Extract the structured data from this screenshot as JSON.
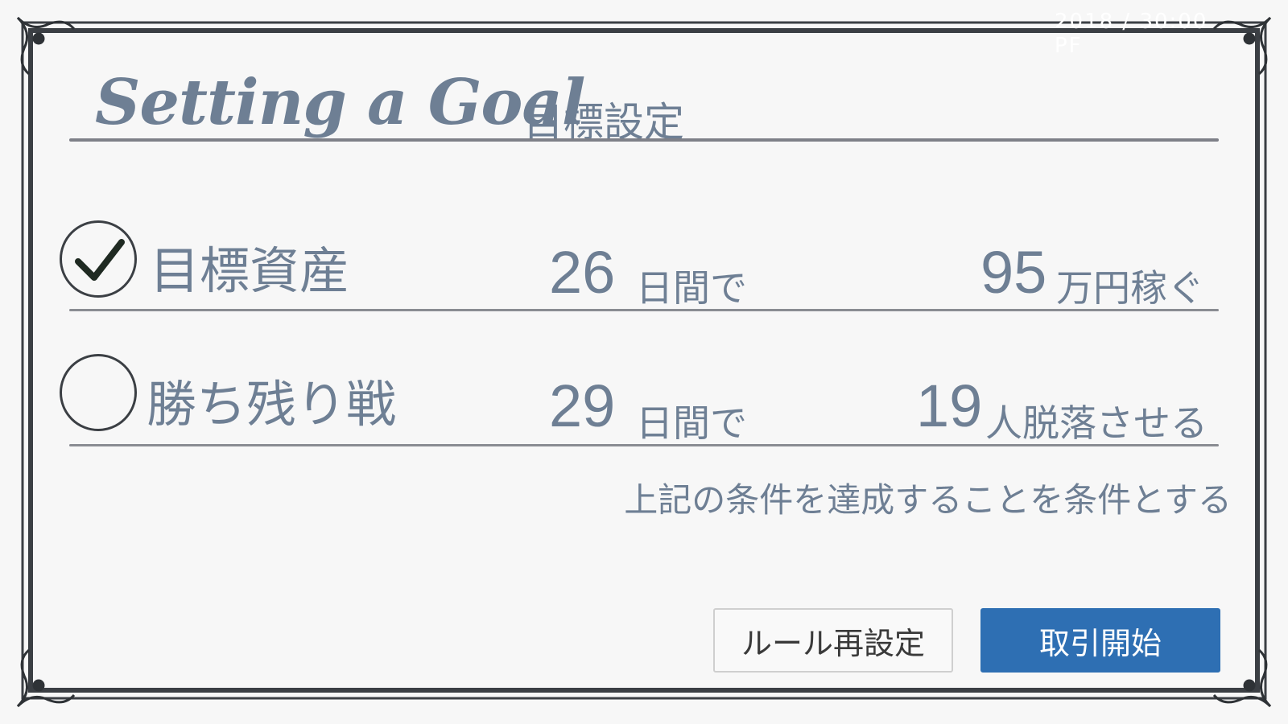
{
  "corner_text": "2018 / 30:00 PF",
  "header": {
    "title_en": "Setting a Goal",
    "title_jp": "目標設定"
  },
  "goals": [
    {
      "checked": true,
      "label": "目標資産",
      "days": "26",
      "days_unit": "日間で",
      "amount": "95",
      "amount_unit": "万円稼ぐ"
    },
    {
      "checked": false,
      "label": "勝ち残り戦",
      "days": "29",
      "days_unit": "日間で",
      "amount": "19",
      "amount_unit": "人脱落させる"
    }
  ],
  "note": "上記の条件を達成することを条件とする",
  "buttons": {
    "reset_label": "ルール再設定",
    "start_label": "取引開始"
  },
  "colors": {
    "text": "#6e7f94",
    "primary": "#2e6fb3",
    "frame": "#3b3f44"
  }
}
